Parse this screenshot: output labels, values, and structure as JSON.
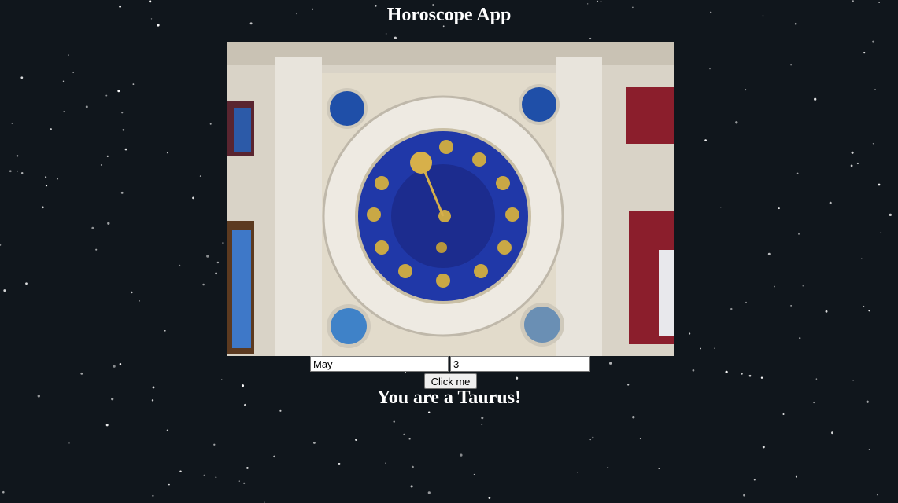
{
  "page": {
    "title": "Horoscope App"
  },
  "hero_image": {
    "subject": "astronomical clock with zodiac signs"
  },
  "form": {
    "month_value": "May",
    "day_value": "3",
    "submit_label": "Click me"
  },
  "result": {
    "text": "You are a Taurus!"
  },
  "colors": {
    "background": "#10161c",
    "text": "#ffffff",
    "clock_blue": "#1f2f9e",
    "clock_gold": "#c9a845"
  },
  "icons": [
    "zodiac-clock-image"
  ]
}
